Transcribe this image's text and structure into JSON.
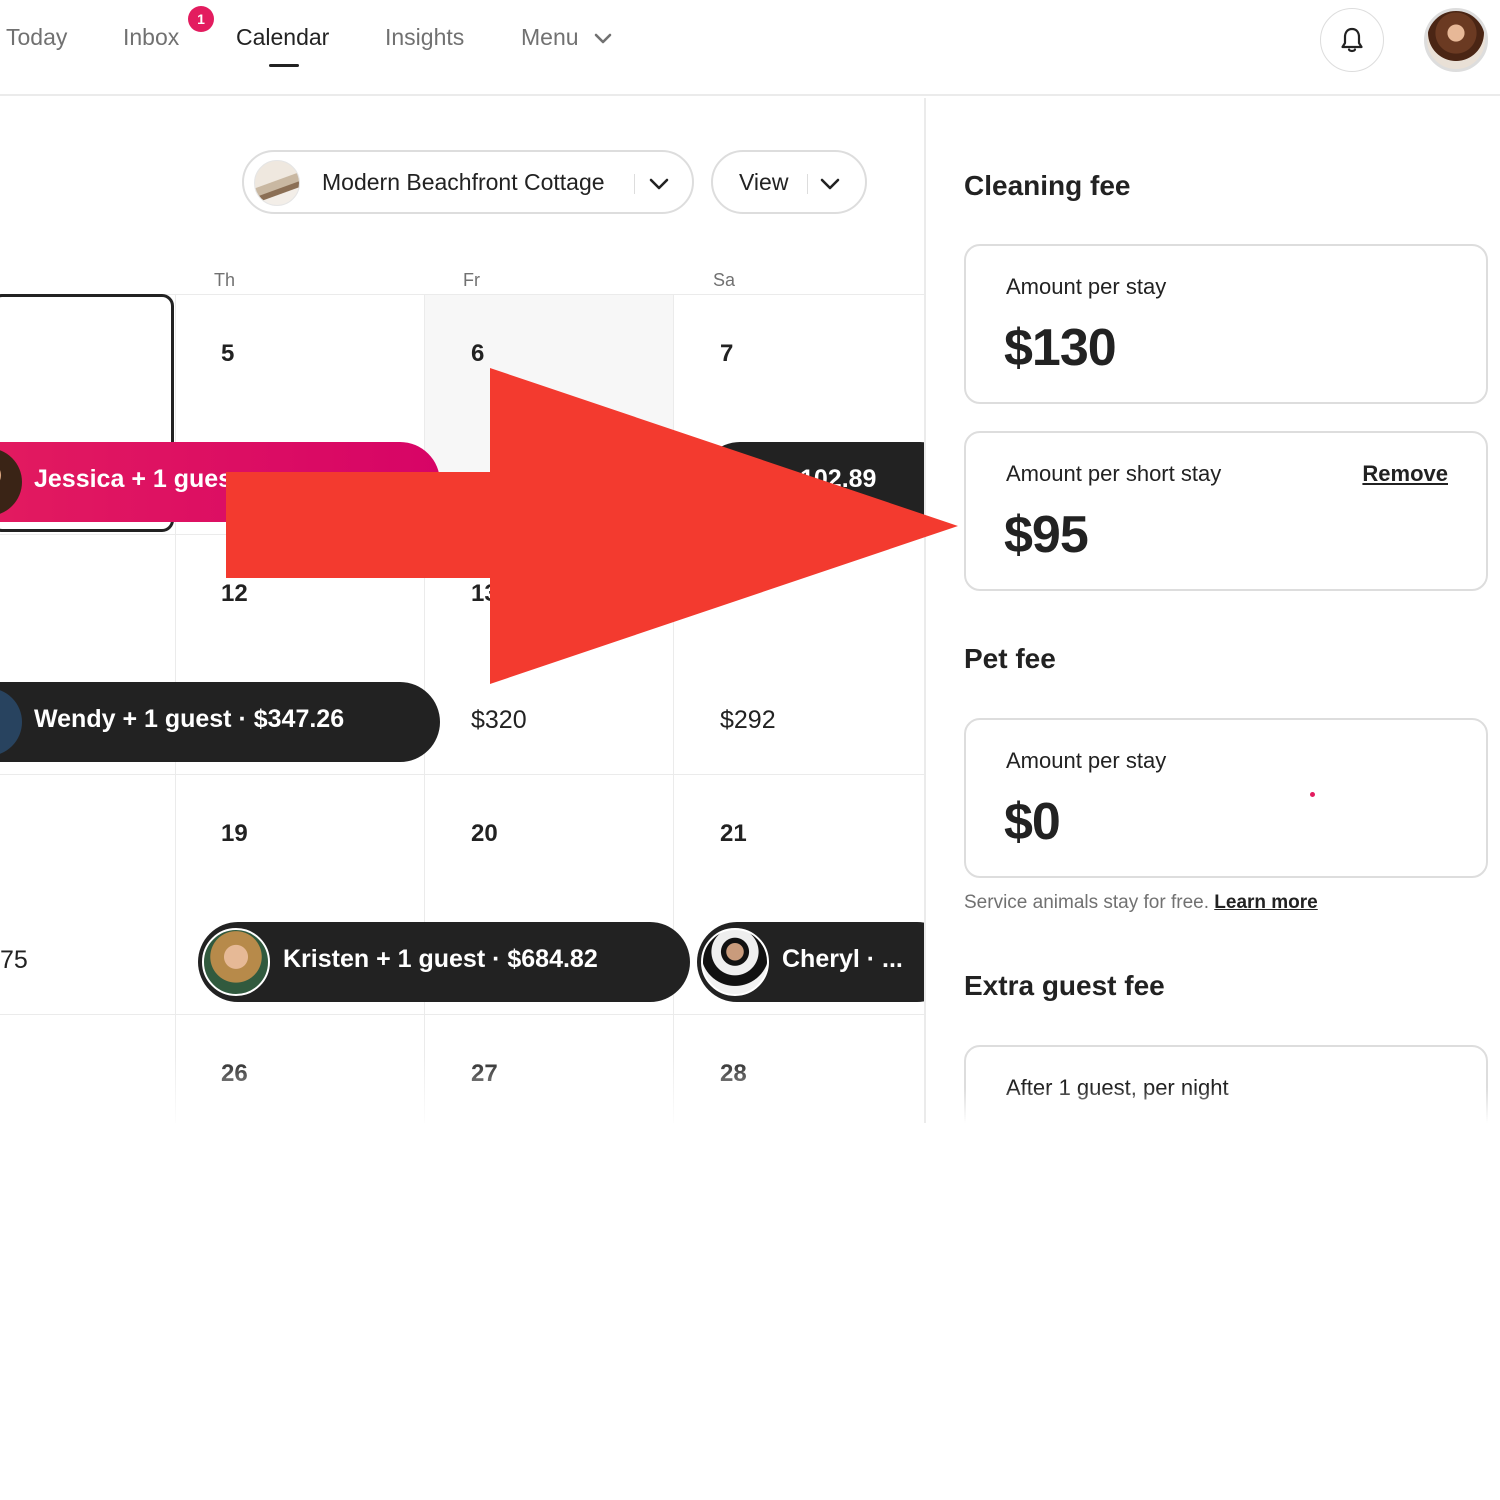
{
  "nav": {
    "items": [
      {
        "label": "Today",
        "active": false
      },
      {
        "label": "Inbox",
        "active": false,
        "badge": "1"
      },
      {
        "label": "Calendar",
        "active": true
      },
      {
        "label": "Insights",
        "active": false
      },
      {
        "label": "Menu",
        "active": false,
        "has_dropdown": true
      }
    ],
    "notification_icon": "bell-icon",
    "profile_icon": "avatar"
  },
  "calendar": {
    "listing_selector": {
      "label": "Modern Beachfront Cottage",
      "icon": "chevron-down-icon"
    },
    "view_selector": {
      "label": "View",
      "icon": "chevron-down-icon"
    },
    "weekdays": [
      "Th",
      "Fr",
      "Sa"
    ],
    "weeks": [
      {
        "days": [
          "5",
          "6",
          "7"
        ]
      },
      {
        "days": [
          "12",
          "13",
          ""
        ]
      },
      {
        "days": [
          "19",
          "20",
          "21"
        ]
      },
      {
        "days": [
          "26",
          "27",
          "28"
        ]
      }
    ],
    "nightly_prices": {
      "fr_week2": "$320",
      "sa_week2": "$292",
      "left_week3": "75"
    },
    "reservations": [
      {
        "label": "Jessica + 1 gues",
        "color": "#e31c5f"
      },
      {
        "label": "102.89",
        "color": "#222222"
      },
      {
        "label": "Wendy + 1 guest  ·  $347.26",
        "color": "#222222"
      },
      {
        "label": "Kristen + 1 guest  ·  $684.82",
        "color": "#222222"
      },
      {
        "label": "Cheryl  ·  ...",
        "color": "#222222"
      }
    ]
  },
  "overlay": {
    "arrow_color": "#f33a2f",
    "direction": "right"
  },
  "fees": {
    "cleaning": {
      "title": "Cleaning fee",
      "per_stay_label": "Amount per stay",
      "per_stay_value": "$130",
      "short_stay_label": "Amount per short stay",
      "short_stay_value": "$95",
      "remove_label": "Remove"
    },
    "pet": {
      "title": "Pet fee",
      "per_stay_label": "Amount per stay",
      "per_stay_value": "$0",
      "helper_text": "Service animals stay for free.",
      "learn_more": "Learn more"
    },
    "extra_guest": {
      "title": "Extra guest fee",
      "label": "After 1 guest, per night"
    }
  },
  "colors": {
    "brand": "#e31c5f",
    "text": "#222222",
    "muted": "#717171",
    "border": "#dddddd"
  }
}
